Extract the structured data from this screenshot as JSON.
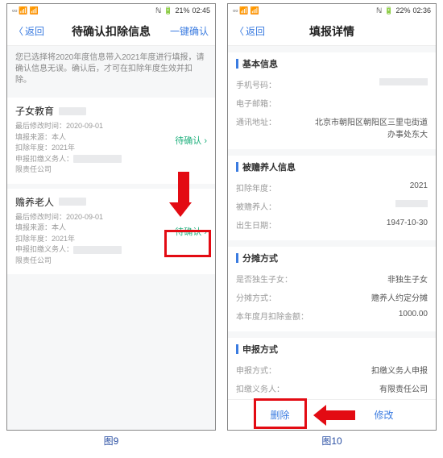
{
  "left": {
    "status": {
      "nfc": "ℕ",
      "battery": "21%",
      "time": "02:45"
    },
    "nav": {
      "back": "返回",
      "title": "待确认扣除信息",
      "right": "一键确认"
    },
    "hint": "您已选择将2020年度信息带入2021年度进行填报，请确认信息无误。确认后，才可在扣除年度生效并扣除。",
    "card1": {
      "title": "子女教育",
      "l1": "最后修改时间：2020-09-01",
      "l2": "填报来源：本人",
      "l3": "扣除年度：2021年",
      "l4": "申报扣缴义务人：",
      "l5": "限责任公司",
      "status": "待确认"
    },
    "card2": {
      "title": "赡养老人",
      "l1": "最后修改时间：2020-09-01",
      "l2": "填报来源：本人",
      "l3": "扣除年度：2021年",
      "l4": "申报扣缴义务人：",
      "l5": "限责任公司",
      "status": "待确认"
    },
    "caption": "图9"
  },
  "right": {
    "status": {
      "nfc": "ℕ",
      "battery": "22%",
      "time": "02:36"
    },
    "nav": {
      "back": "返回",
      "title": "填报详情"
    },
    "sec_basic": {
      "title": "基本信息",
      "phone_k": "手机号码：",
      "email_k": "电子邮箱：",
      "addr_k": "通讯地址：",
      "addr_v": "北京市朝阳区朝阳区三里屯街道办事处东大"
    },
    "sec_dep": {
      "title": "被赡养人信息",
      "year_k": "扣除年度：",
      "year_v": "2021",
      "dep_k": "被赡养人：",
      "dob_k": "出生日期：",
      "dob_v": "1947-10-30"
    },
    "sec_share": {
      "title": "分摊方式",
      "only_k": "是否独生子女：",
      "only_v": "非独生子女",
      "mode_k": "分摊方式：",
      "mode_v": "赡养人约定分摊",
      "amt_k": "本年度月扣除金额：",
      "amt_v": "1000.00"
    },
    "sec_decl": {
      "title": "申报方式",
      "way_k": "申报方式：",
      "way_v": "扣缴义务人申报",
      "agent_k": "扣缴义务人：",
      "agent_v": "有限责任公司"
    },
    "footer": {
      "delete": "删除",
      "edit": "修改"
    },
    "caption": "图10"
  }
}
